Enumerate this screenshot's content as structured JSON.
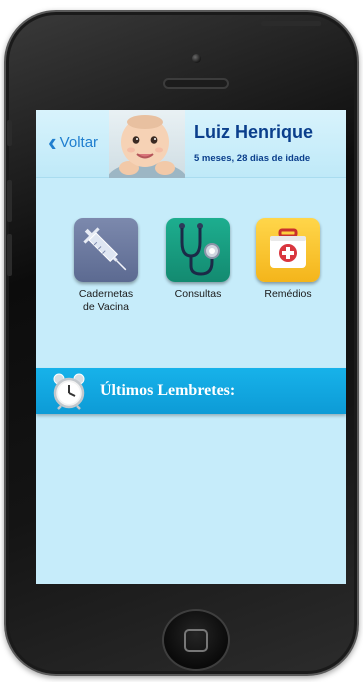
{
  "header": {
    "back_label": "Voltar",
    "child_name": "Luiz Henrique",
    "child_age": "5 meses, 28 dias de idade"
  },
  "menu": [
    {
      "label": "Cadernetas\nde Vacina",
      "icon": "syringe-icon"
    },
    {
      "label": "Consultas",
      "icon": "stethoscope-icon"
    },
    {
      "label": "Remédios",
      "icon": "first-aid-kit-icon"
    }
  ],
  "reminders": {
    "title": "Últimos Lembretes:",
    "icon": "alarm-clock-icon"
  },
  "colors": {
    "screen_bg": "#c6ecfa",
    "banner": "#14a9e3",
    "title_text": "#0b3f8c",
    "back_link": "#1f7ecf"
  }
}
